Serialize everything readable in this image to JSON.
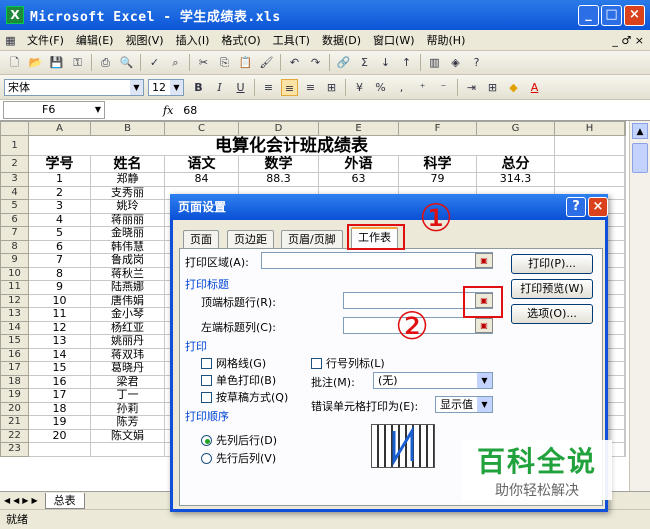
{
  "window": {
    "title": "Microsoft Excel - 学生成绩表.xls"
  },
  "menu": [
    "文件(F)",
    "编辑(E)",
    "视图(V)",
    "插入(I)",
    "格式(O)",
    "工具(T)",
    "数据(D)",
    "窗口(W)",
    "帮助(H)"
  ],
  "menu_right": "_ ♂ ×",
  "format_bar": {
    "font": "宋体",
    "size": "12",
    "bold": "B",
    "italic": "I",
    "underline": "U"
  },
  "formula_bar": {
    "cell": "F6",
    "fx": "fx",
    "value": "68"
  },
  "columns": [
    "A",
    "B",
    "C",
    "D",
    "E",
    "F",
    "G",
    "H"
  ],
  "sheet": {
    "title": "电算化会计班成绩表",
    "headers": [
      "学号",
      "姓名",
      "语文",
      "数学",
      "外语",
      "科学",
      "总分"
    ],
    "first_row": [
      "1",
      "郑静",
      "84",
      "88.3",
      "63",
      "79",
      "314.3"
    ],
    "students": [
      [
        "2",
        "支秀丽"
      ],
      [
        "3",
        "姚玲"
      ],
      [
        "4",
        "蒋丽丽"
      ],
      [
        "5",
        "金晓丽"
      ],
      [
        "6",
        "韩伟慧"
      ],
      [
        "7",
        "鲁成岗"
      ],
      [
        "8",
        "蒋秋兰"
      ],
      [
        "9",
        "陆燕娜"
      ],
      [
        "10",
        "唐伟娟"
      ],
      [
        "11",
        "金小琴"
      ],
      [
        "12",
        "杨红亚"
      ],
      [
        "13",
        "姚丽丹"
      ],
      [
        "14",
        "蒋双玮"
      ],
      [
        "15",
        "葛晓丹"
      ],
      [
        "16",
        "梁君"
      ],
      [
        "17",
        "丁一"
      ],
      [
        "18",
        "孙莉"
      ],
      [
        "19",
        "陈芳"
      ],
      [
        "20",
        "陈文娟"
      ]
    ],
    "row_numbers": [
      "1",
      "2",
      "3",
      "4",
      "5",
      "6",
      "7",
      "8",
      "9",
      "10",
      "11",
      "12",
      "13",
      "14",
      "15",
      "16",
      "17",
      "18",
      "19",
      "20",
      "21",
      "22",
      "23"
    ]
  },
  "sheet_tab": "总表",
  "status": "就绪",
  "dialog": {
    "title": "页面设置",
    "tabs": [
      "页面",
      "页边距",
      "页眉/页脚",
      "工作表"
    ],
    "print_area_label": "打印区域(A):",
    "print_titles_group": "打印标题",
    "top_rows_label": "顶端标题行(R):",
    "left_cols_label": "左端标题列(C):",
    "print_group": "打印",
    "gridlines": "网格线(G)",
    "row_col_headers": "行号列标(L)",
    "mono": "单色打印(B)",
    "comments_label": "批注(M):",
    "comments_value": "(无)",
    "draft": "按草稿方式(Q)",
    "errors_label": "错误单元格打印为(E):",
    "errors_value": "显示值",
    "order_group": "打印顺序",
    "order_down": "先列后行(D)",
    "order_over": "先行后列(V)",
    "btn_print": "打印(P)...",
    "btn_preview": "打印预览(W)",
    "btn_options": "选项(O)..."
  },
  "annotations": {
    "one": "①",
    "two": "②"
  },
  "watermark": {
    "line1": "百科全说",
    "line2": "助你轻松解决"
  }
}
